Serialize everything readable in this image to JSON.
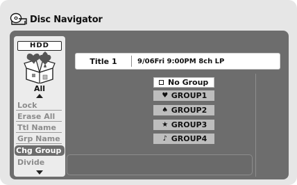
{
  "header": {
    "title": "Disc Navigator",
    "icon": "disc-navigator-icon"
  },
  "sidebar": {
    "media_label": "HDD",
    "group_icon": "hearts-spades-box-icon",
    "filter_label": "All",
    "items": [
      {
        "label": "Lock",
        "selected": false
      },
      {
        "label": "Erase All",
        "selected": false
      },
      {
        "label": "Ttl Name",
        "selected": false
      },
      {
        "label": "Grp Name",
        "selected": false
      },
      {
        "label": "Chg Group",
        "selected": true
      },
      {
        "label": "Divide",
        "selected": false
      }
    ]
  },
  "title_info": {
    "title": "Title 1",
    "details": "9/06Fri  9:00PM  8ch LP"
  },
  "group_options": [
    {
      "label": "No Group",
      "icon": "square-icon",
      "symbol": "",
      "current": true
    },
    {
      "label": "GROUP1",
      "icon": "heart-icon",
      "symbol": "♥",
      "current": false
    },
    {
      "label": "GROUP2",
      "icon": "spade-icon",
      "symbol": "♠",
      "current": false
    },
    {
      "label": "GROUP3",
      "icon": "star-icon",
      "symbol": "★",
      "current": false
    },
    {
      "label": "GROUP4",
      "icon": "music-note-icon",
      "symbol": "♪",
      "current": false
    }
  ],
  "colors": {
    "panel": "#6d6d6d",
    "background": "#e6e6e6",
    "menu_text": "#8c8c8c",
    "option_bg": "#bdbdbd"
  }
}
